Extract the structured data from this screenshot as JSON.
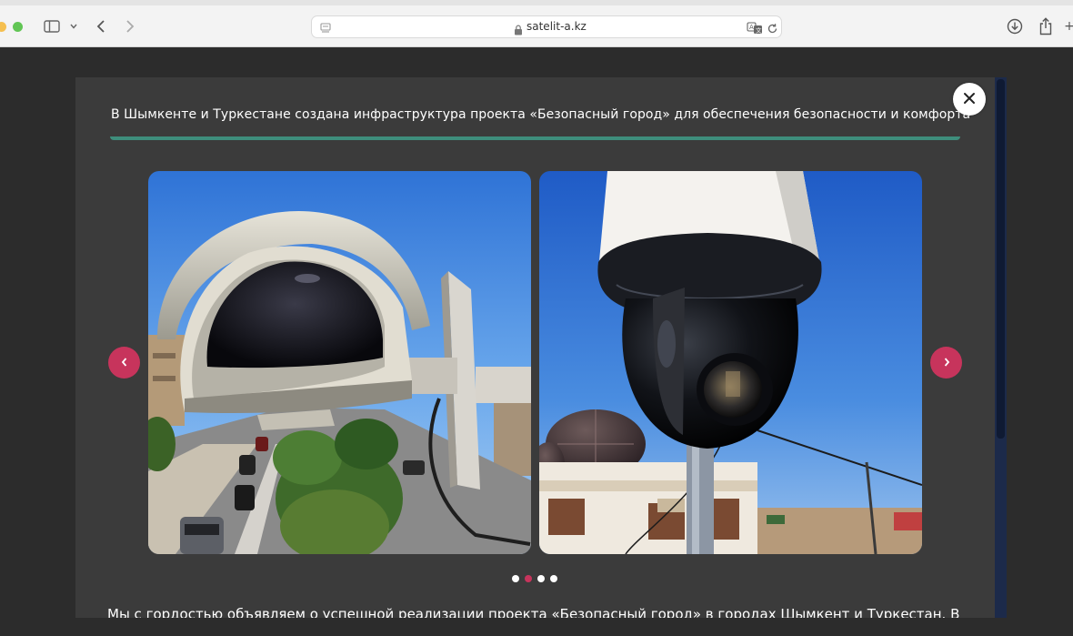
{
  "browser": {
    "url": "satelit-a.kz",
    "icons": [
      "sidebar-icon",
      "chevron-down-icon",
      "back-icon",
      "forward-icon",
      "lock-icon",
      "translate-icon",
      "reload-icon",
      "download-icon",
      "share-icon"
    ]
  },
  "modal": {
    "title": "В Шымкенте и Туркестане создана инфраструктура проекта «Безопасный город» для обеспечения безопасности и комфорта",
    "close_icon": "close-icon",
    "carousel": {
      "slides": [
        {
          "alt": "security-camera-housing-photo"
        },
        {
          "alt": "dome-ptz-camera-photo"
        }
      ],
      "dot_count": 4,
      "active_index": 1
    },
    "body_text": "Мы с гордостью объявляем о успешной реализации проекта «Безопасный город» в городах Шымкент и Туркестан. В"
  },
  "colors": {
    "accent": "#c7345c",
    "underline": "#3e8e7c",
    "modal_bg": "#3b3b3b",
    "page_bg": "#2c2c2c"
  }
}
